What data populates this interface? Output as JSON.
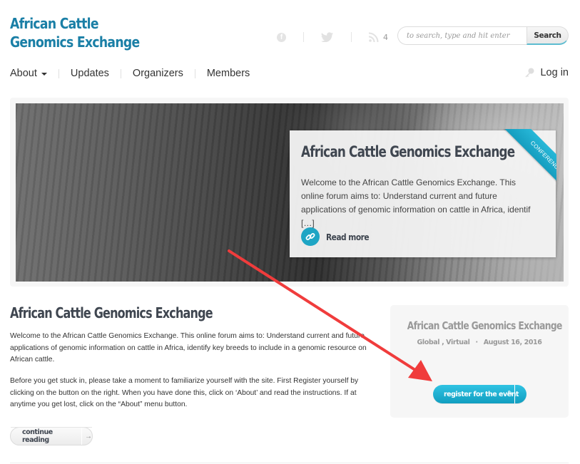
{
  "site": {
    "title": "African Cattle Genomics Exchange",
    "title_color": "#1a7fa6",
    "accent_color": "#1ea5c4"
  },
  "social": {
    "icons": [
      "facebook-icon",
      "twitter-icon",
      "rss-icon"
    ],
    "rss_count": "4"
  },
  "search": {
    "placeholder": "to search, type and hit enter",
    "value": "",
    "button_label": "Search"
  },
  "nav": {
    "items": [
      {
        "label": "About",
        "has_dropdown": true
      },
      {
        "label": "Updates"
      },
      {
        "label": "Organizers"
      },
      {
        "label": "Members"
      }
    ],
    "login_label": "Log in"
  },
  "hero": {
    "ribbon_label": "CONFERENCE",
    "title": "African Cattle Genomics Exchange",
    "excerpt": "Welcome to the African Cattle Genomics Exchange. This online forum aims to: Understand current and future applications of genomic information on cattle in Africa, identif […]",
    "read_more_label": "Read more"
  },
  "post": {
    "title": "African Cattle Genomics Exchange",
    "paragraphs": [
      "Welcome to the African Cattle Genomics Exchange. This online forum aims to: Understand current and future applications of genomic information on cattle in Africa, identify key breeds to include in a genomic resource on African cattle.",
      "Before you get stuck in, please take a moment to familiarize yourself with the site. First Register yourself by clicking on the button on the right. When you have done this, click on ‘About’ and read the instructions. If at anytime you get lost, click on the “About” menu button."
    ],
    "continue_label": "continue reading",
    "continue_arrow": "→"
  },
  "event": {
    "title": "African Cattle Genomics Exchange",
    "location": "Global , Virtual",
    "separator": "·",
    "date": "August 16, 2016",
    "register_label": "register for the event"
  },
  "annotation": {
    "arrow_color": "#f03c3c"
  }
}
